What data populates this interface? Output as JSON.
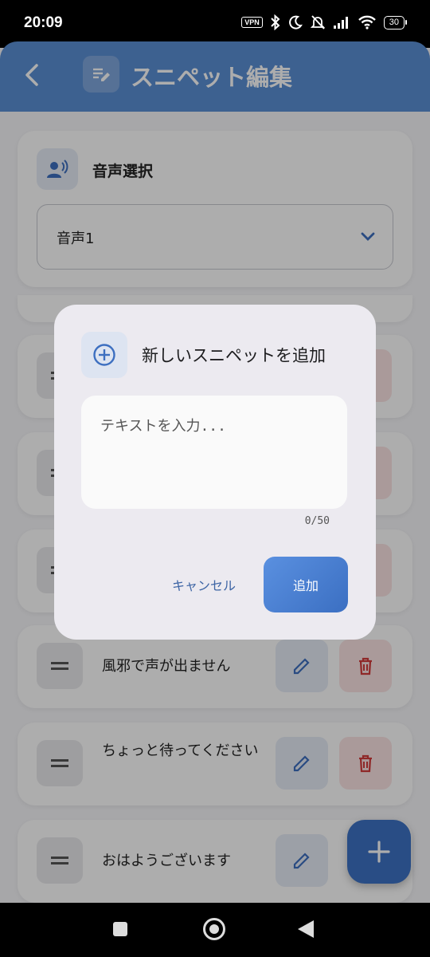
{
  "status_bar": {
    "time": "20:09",
    "vpn": "VPN",
    "battery": "30",
    "icons": [
      "bluetooth-icon",
      "moon-icon",
      "mute-icon",
      "signal-icon",
      "wifi-icon"
    ]
  },
  "app_bar": {
    "title": "スニペット編集",
    "back_icon": "chevron-left-icon",
    "title_icon": "edit-note-icon"
  },
  "voice_select": {
    "label": "音声選択",
    "icon": "record-voice-icon",
    "value": "音声1"
  },
  "snippets": [
    {
      "text": "風邪で声が出ません"
    },
    {
      "text": "ちょっと待ってください"
    },
    {
      "text": "おはようございます"
    }
  ],
  "dialog": {
    "title": "新しいスニペットを追加",
    "placeholder": "テキストを入力...",
    "counter": "0/50",
    "cancel_label": "キャンセル",
    "add_label": "追加"
  },
  "colors": {
    "primary": "#5b8fd4",
    "fab": "#3d72c4",
    "delete": "#d33b3b",
    "dialog_bg": "#eceaf0"
  }
}
